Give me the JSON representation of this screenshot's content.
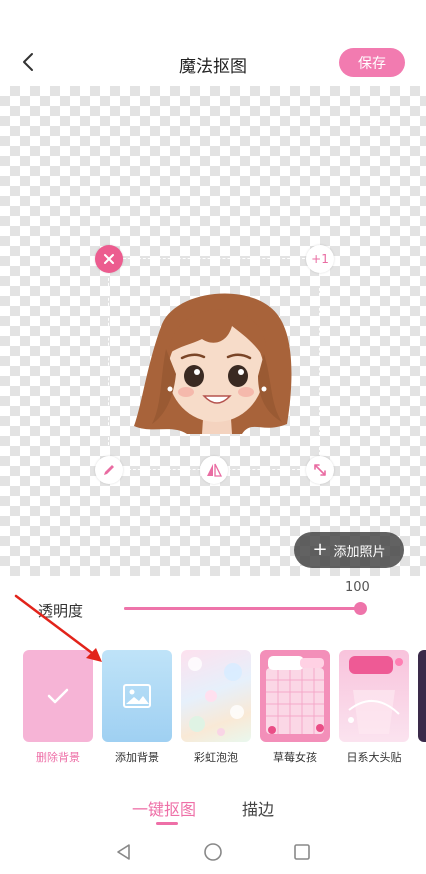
{
  "header": {
    "title": "魔法抠图",
    "save_label": "保存"
  },
  "canvas": {
    "plus_one_label": "+1",
    "add_photo_label": "添加照片"
  },
  "opacity": {
    "label": "透明度",
    "value": "100",
    "level_percent": 100
  },
  "backgrounds": [
    {
      "label": "删除背景",
      "selected": true
    },
    {
      "label": "添加背景",
      "selected": false
    },
    {
      "label": "彩虹泡泡",
      "selected": false
    },
    {
      "label": "草莓女孩",
      "selected": false
    },
    {
      "label": "日系大头贴",
      "selected": false
    }
  ],
  "tabs": [
    {
      "label": "一键抠图",
      "active": true
    },
    {
      "label": "描边",
      "active": false
    }
  ],
  "colors": {
    "accent": "#ee6fa7",
    "save_button": "#f27bb0"
  }
}
